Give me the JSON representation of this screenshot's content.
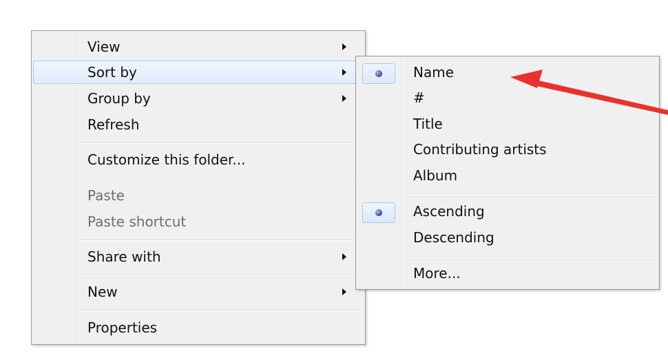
{
  "main_menu": {
    "items": [
      {
        "label": "View",
        "has_submenu": true
      },
      {
        "label": "Sort by",
        "has_submenu": true,
        "highlighted": true
      },
      {
        "label": "Group by",
        "has_submenu": true
      },
      {
        "label": "Refresh"
      },
      {
        "label": "Customize this folder..."
      },
      {
        "label": "Paste",
        "disabled": true
      },
      {
        "label": "Paste shortcut",
        "disabled": true
      },
      {
        "label": "Share with",
        "has_submenu": true
      },
      {
        "label": "New",
        "has_submenu": true
      },
      {
        "label": "Properties"
      }
    ]
  },
  "sort_menu": {
    "items": [
      {
        "label": "Name",
        "checked": true
      },
      {
        "label": "#"
      },
      {
        "label": "Title"
      },
      {
        "label": "Contributing artists"
      },
      {
        "label": "Album"
      },
      {
        "label": "Ascending",
        "checked": true
      },
      {
        "label": "Descending"
      },
      {
        "label": "More..."
      }
    ]
  },
  "colors": {
    "annotation_arrow": "#e8322d",
    "radio_dot": "#3a3f9c"
  },
  "icons": {
    "submenu_indicator": "chevron-right-icon",
    "radio": "radio-dot-icon"
  }
}
